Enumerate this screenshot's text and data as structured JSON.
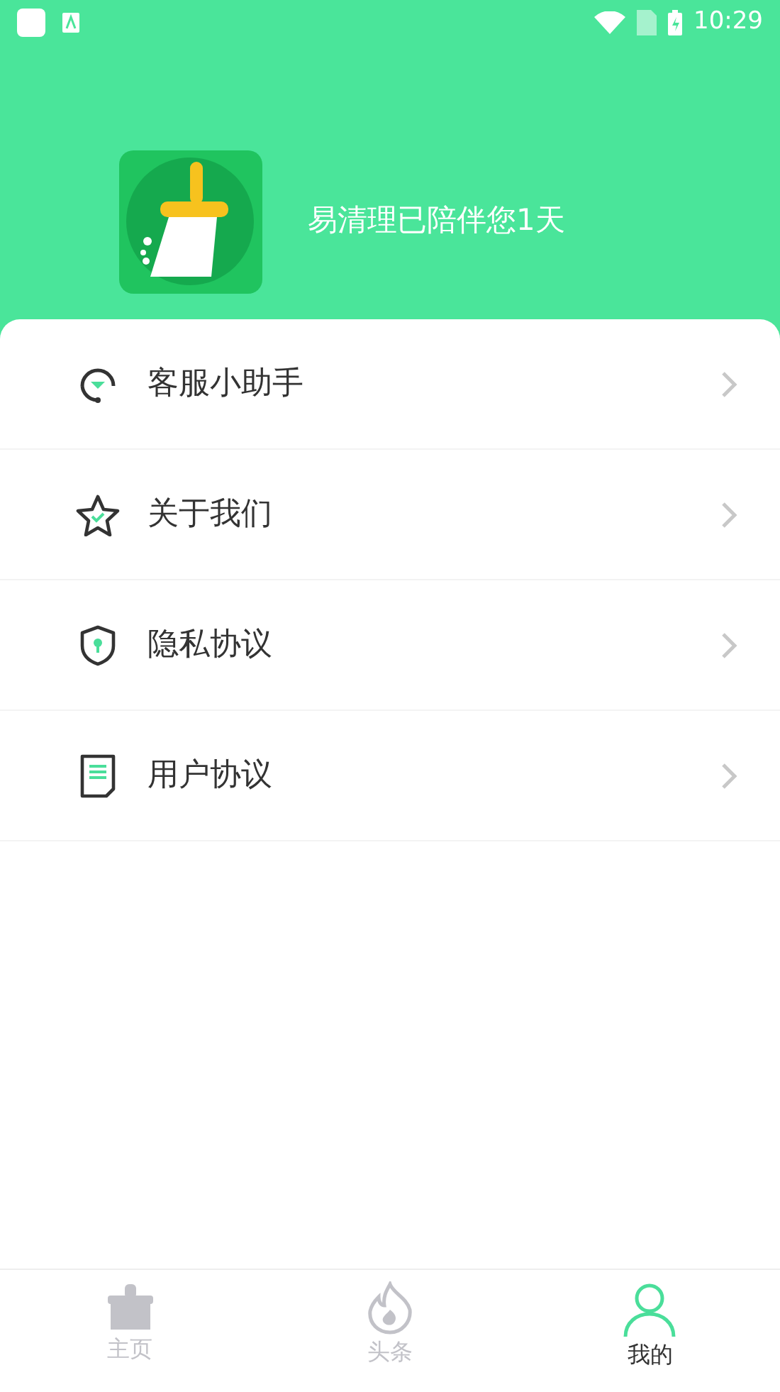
{
  "status_bar": {
    "time": "10:29"
  },
  "header": {
    "greeting": "易清理已陪伴您1天"
  },
  "menu": [
    {
      "kind": "support",
      "label": "客服小助手"
    },
    {
      "kind": "about",
      "label": "关于我们"
    },
    {
      "kind": "privacy",
      "label": "隐私协议"
    },
    {
      "kind": "terms",
      "label": "用户协议"
    }
  ],
  "tabs": [
    {
      "kind": "home",
      "label": "主页",
      "selected": false
    },
    {
      "kind": "news",
      "label": "头条",
      "selected": false
    },
    {
      "kind": "profile",
      "label": "我的",
      "selected": true
    }
  ]
}
